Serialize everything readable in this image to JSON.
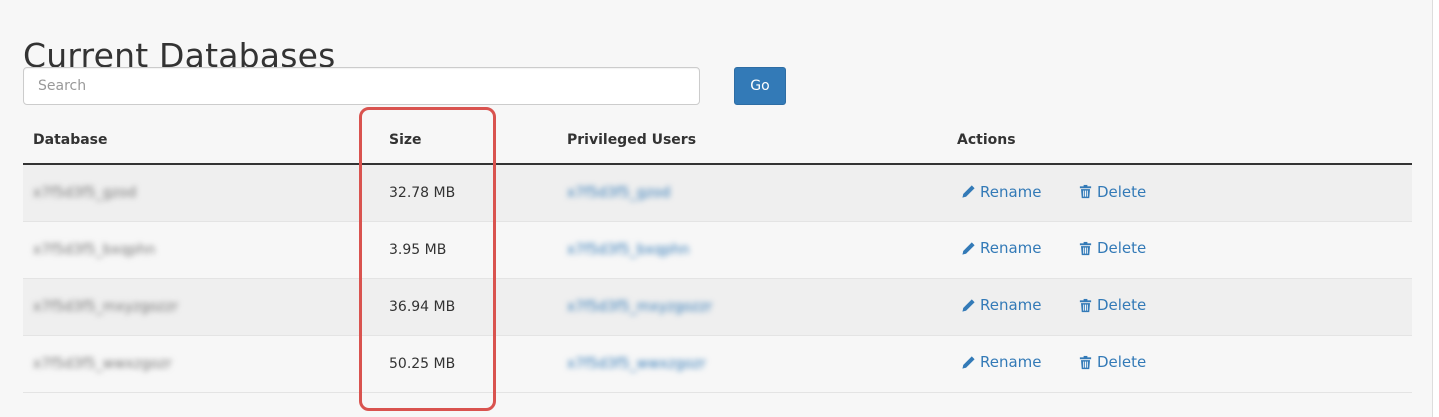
{
  "page": {
    "title": "Current Databases"
  },
  "search": {
    "placeholder": "Search",
    "value": "",
    "go_label": "Go"
  },
  "table": {
    "headers": {
      "database": "Database",
      "size": "Size",
      "privileged_users": "Privileged Users",
      "actions": "Actions"
    },
    "rows": [
      {
        "database": "x7f5d3f5_gzod",
        "size": "32.78 MB",
        "user": "x7f5d3f5_gzod",
        "rename": "Rename",
        "delete": "Delete"
      },
      {
        "database": "x7f5d3f5_bxqphn",
        "size": "3.95 MB",
        "user": "x7f5d3f5_bxqphn",
        "rename": "Rename",
        "delete": "Delete"
      },
      {
        "database": "x7f5d3f5_mxyzgozzr",
        "size": "36.94 MB",
        "user": "x7f5d3f5_mxyzgozzr",
        "rename": "Rename",
        "delete": "Delete"
      },
      {
        "database": "x7f5d3f5_wwxzgozr",
        "size": "50.25 MB",
        "user": "x7f5d3f5_wwxzgozr",
        "rename": "Rename",
        "delete": "Delete"
      }
    ]
  },
  "icons": {
    "rename": "pencil-icon",
    "delete": "trash-icon",
    "user_remove": "user-remove-icon"
  },
  "colors": {
    "link": "#337ab7",
    "primary_button": "#337ab7",
    "highlight": "#d9534f"
  }
}
